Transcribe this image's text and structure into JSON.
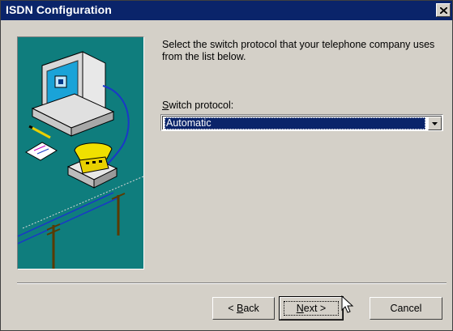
{
  "window": {
    "title": "ISDN Configuration",
    "close_icon": "close-icon"
  },
  "content": {
    "instruction": "Select the switch protocol that your telephone company uses from the list below.",
    "protocol_label_mnemonic": "S",
    "protocol_label_rest": "witch protocol:",
    "protocol_value": "Automatic",
    "dropdown_icon": "dropdown-arrow-icon"
  },
  "illustration": {
    "description_icon": "isdn-computer-phone-illustration",
    "background_color": "#0f7d7d"
  },
  "buttons": {
    "back_prefix": "< ",
    "back_mnemonic": "B",
    "back_rest": "ack",
    "next_mnemonic": "N",
    "next_rest": "ext >",
    "cancel": "Cancel"
  },
  "colors": {
    "titlebar": "#0a246a",
    "face": "#d4d0c8",
    "selection": "#0a246a"
  }
}
